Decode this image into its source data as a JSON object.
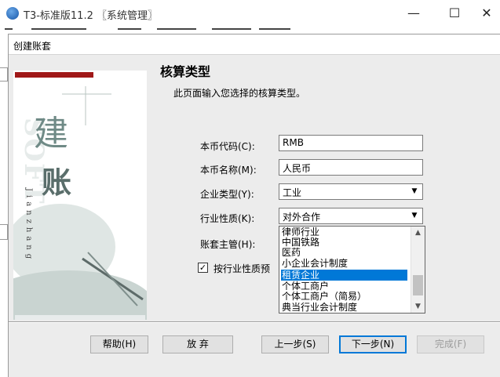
{
  "window": {
    "title": "T3-标准版11.2 〖系统管理〗",
    "minimize": "—",
    "maximize": "☐",
    "close": "✕"
  },
  "dialog": {
    "title": "创建账套",
    "side_glyph_1": "建",
    "side_glyph_2": "账",
    "side_ghost": "SOFT",
    "side_pinyin": "Jianzhang",
    "heading": "核算类型",
    "subtitle": "此页面输入您选择的核算类型。",
    "form": {
      "currency_code_label": "本币代码(C):",
      "currency_code_value": "RMB",
      "currency_name_label": "本币名称(M):",
      "currency_name_value": "人民币",
      "enterprise_type_label": "企业类型(Y):",
      "enterprise_type_value": "工业",
      "industry_label": "行业性质(K):",
      "industry_value": "对外合作",
      "supervisor_label": "账套主管(H):"
    },
    "dropdown_items": [
      "律师行业",
      "中国铁路",
      "医药",
      "小企业会计制度",
      "租赁企业",
      "个体工商户",
      "个体工商户（简易）",
      "典当行业会计制度"
    ],
    "selected_index": 4,
    "checkbox_label": "按行业性质预",
    "checkbox_checked": true,
    "checkbox_mark": "✓",
    "buttons": {
      "help": "帮助(H)",
      "abandon": "放 弃",
      "prev": "上一步(S)",
      "next": "下一步(N)",
      "finish": "完成(F)"
    }
  }
}
